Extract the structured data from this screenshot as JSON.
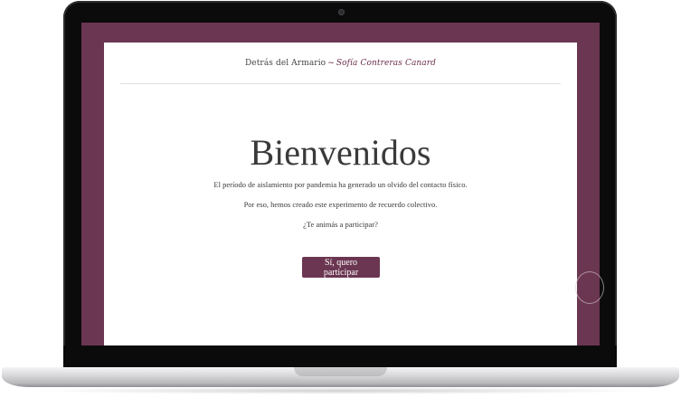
{
  "header": {
    "site_name": "Detrás del Armario",
    "separator": "~",
    "author": "Sofía Contreras Canard"
  },
  "hero": {
    "title": "Bienvenidos",
    "paragraph_1": "El período de aislamiento por pandemia ha generado un olvido del contacto físico.",
    "paragraph_2": "Por eso, hemos creado este experimento de recuerdo colectivo.",
    "paragraph_3": "¿Te animás a participar?",
    "cta_label": "Sí, quero participar"
  },
  "colors": {
    "accent": "#6b3651",
    "page_bg": "#ffffff",
    "text": "#3a3a3a"
  }
}
